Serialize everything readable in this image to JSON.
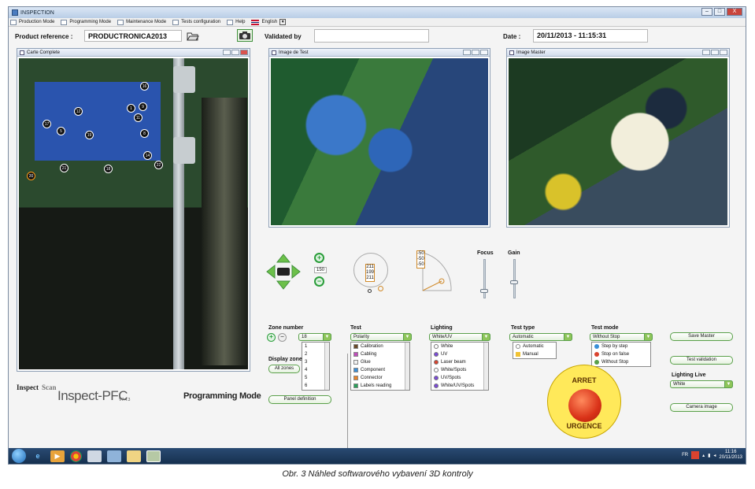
{
  "window": {
    "title": "INSPECTION",
    "controls": [
      "–",
      "□",
      "X"
    ]
  },
  "menu": {
    "items": [
      "Production Mode",
      "Programming Mode",
      "Maintenance Mode",
      "Tests configuration",
      "Help"
    ],
    "language": "English"
  },
  "header": {
    "product_reference_label": "Product reference :",
    "product_reference_value": "PRODUCTRONICA2013",
    "validated_by_label": "Validated by",
    "validated_by_value": "",
    "date_label": "Date :",
    "date_value": "20/11/2013 - 11:15:31"
  },
  "panels": {
    "complete": "Carte Complete",
    "test": "Image de Test",
    "master": "Image Master"
  },
  "markers": [
    "16",
    "9",
    "1",
    "12",
    "11",
    "17",
    "5",
    "8",
    "19",
    "14",
    "21",
    "18",
    "22",
    "20"
  ],
  "branding": {
    "logo_left": "Inspect",
    "logo_mid": "Scan",
    "product": "Inspect-PFC",
    "version": "V7.4.3",
    "mode": "Programming Mode"
  },
  "camera": {
    "zoom_value": "150",
    "rotation_values": [
      "211",
      "199",
      "211"
    ],
    "angle_values": [
      "-50",
      "-50",
      "-50"
    ],
    "focus_label": "Focus",
    "gain_label": "Gain",
    "focus_level": 0.85,
    "gain_level": 0.6
  },
  "zone": {
    "label": "Zone number",
    "selected": "18",
    "options": [
      "1",
      "2",
      "3",
      "4",
      "5",
      "6"
    ],
    "display_label": "Display zone",
    "all_zones_btn": "All zones",
    "panel_def_btn": "Panel definition"
  },
  "test": {
    "label": "Test",
    "selected": "Polarity",
    "options": [
      {
        "label": "Calibration",
        "color": "#6a4a2a"
      },
      {
        "label": "Cabling",
        "color": "#c04dbb"
      },
      {
        "label": "Glue",
        "color": "#f2f2f2"
      },
      {
        "label": "Component",
        "color": "#3a8fd8"
      },
      {
        "label": "Connector",
        "color": "#e8842a"
      },
      {
        "label": "Labels reading",
        "color": "#2aa05a"
      }
    ]
  },
  "lighting": {
    "label": "Lighting",
    "selected": "White/UV",
    "options": [
      "White",
      "UV",
      "Laser beam",
      "White/Spots",
      "UV/Spots",
      "White/UV/Spots"
    ]
  },
  "test_type": {
    "label": "Test type",
    "selected": "Automatic",
    "options": [
      "Automatic",
      "Manual"
    ]
  },
  "test_mode": {
    "label": "Test mode",
    "selected": "Without Stop",
    "options": [
      "Step by step",
      "Stop on false",
      "Without Stop"
    ]
  },
  "actions": {
    "save_master": "Save Master",
    "test_validation": "Test validation",
    "lighting_live_label": "Lighting Live",
    "lighting_live_value": "White",
    "camera_image": "Camera image"
  },
  "estop": {
    "top": "ARRET",
    "bottom": "URGENCE"
  },
  "taskbar": {
    "lang": "FR",
    "time": "11:16",
    "date": "20/11/2013"
  },
  "caption": "Obr. 3  Náhled softwarového vybavení 3D kontroly"
}
